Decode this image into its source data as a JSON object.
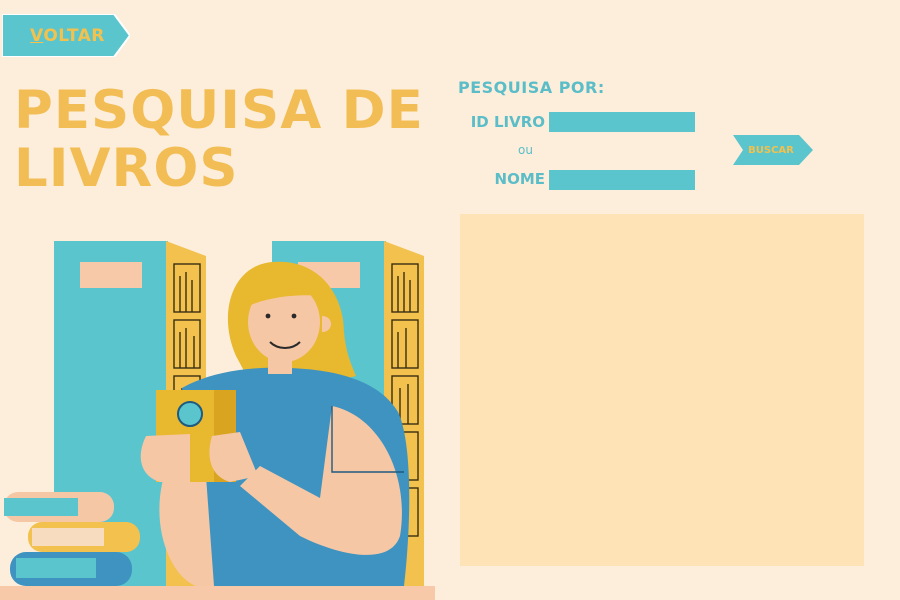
{
  "nav": {
    "back_label": "VOLTAR"
  },
  "title": {
    "line1": "PESQUISA DE",
    "line2": "LIVROS"
  },
  "search": {
    "heading": "PESQUISA POR:",
    "id_label": "ID LIVRO",
    "or_label": "ou",
    "name_label": "NOME",
    "id_value": "",
    "name_value": "",
    "button_label": "BUSCAR"
  },
  "colors": {
    "background": "#fdeedb",
    "accent_teal": "#5bc5cd",
    "accent_yellow": "#f3bd55",
    "results_panel": "#fde3b6"
  }
}
